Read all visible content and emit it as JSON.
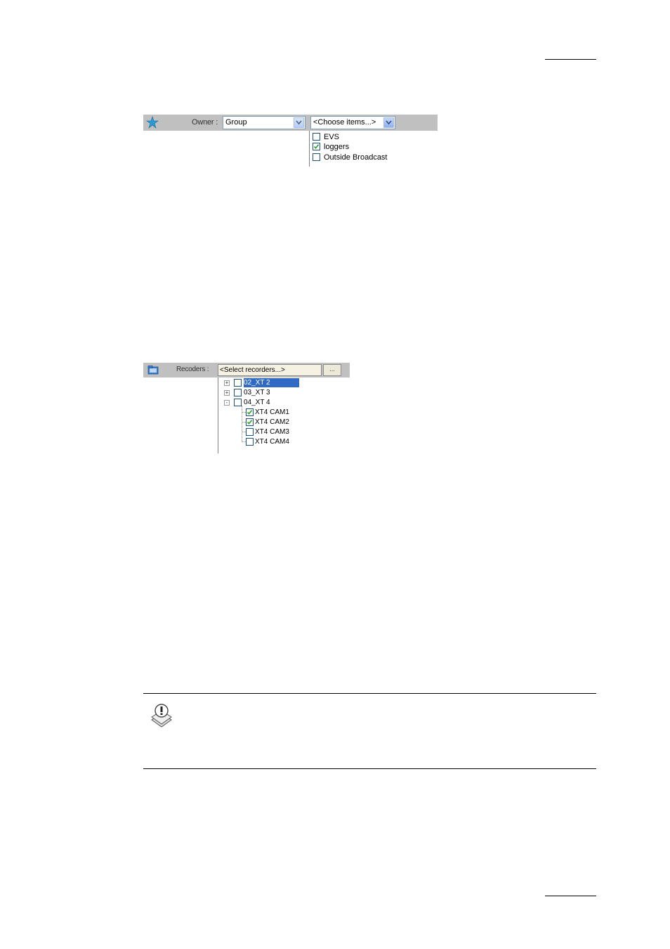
{
  "owner_filter": {
    "label": "Owner :",
    "owner_combo_value": "Group",
    "items_combo_value": "<Choose items...>",
    "options": [
      {
        "label": "EVS",
        "checked": false
      },
      {
        "label": "loggers",
        "checked": true
      },
      {
        "label": "Outside Broadcast",
        "checked": false
      }
    ]
  },
  "recorders_filter": {
    "label": "Recoders :",
    "input_value": "<Select recorders...>",
    "browse_label": "...",
    "tree": [
      {
        "label": "02_XT 2",
        "expander": "+",
        "checked": false,
        "selected": true
      },
      {
        "label": "03_XT 3",
        "expander": "+",
        "checked": false,
        "selected": false
      },
      {
        "label": "04_XT 4",
        "expander": "-",
        "checked": false,
        "selected": false
      },
      {
        "label": "XT4 CAM1",
        "checked": true
      },
      {
        "label": "XT4 CAM2",
        "checked": true
      },
      {
        "label": "XT4 CAM3",
        "checked": false
      },
      {
        "label": "XT4 CAM4",
        "checked": false
      }
    ]
  },
  "icons": {
    "owner": "owner-star-icon",
    "recorders": "recorder-folder-icon",
    "note": "note-warning-icon"
  },
  "colors": {
    "bar_background": "#c0c0c0",
    "selection": "#316ac5",
    "check_green": "#21a121"
  }
}
